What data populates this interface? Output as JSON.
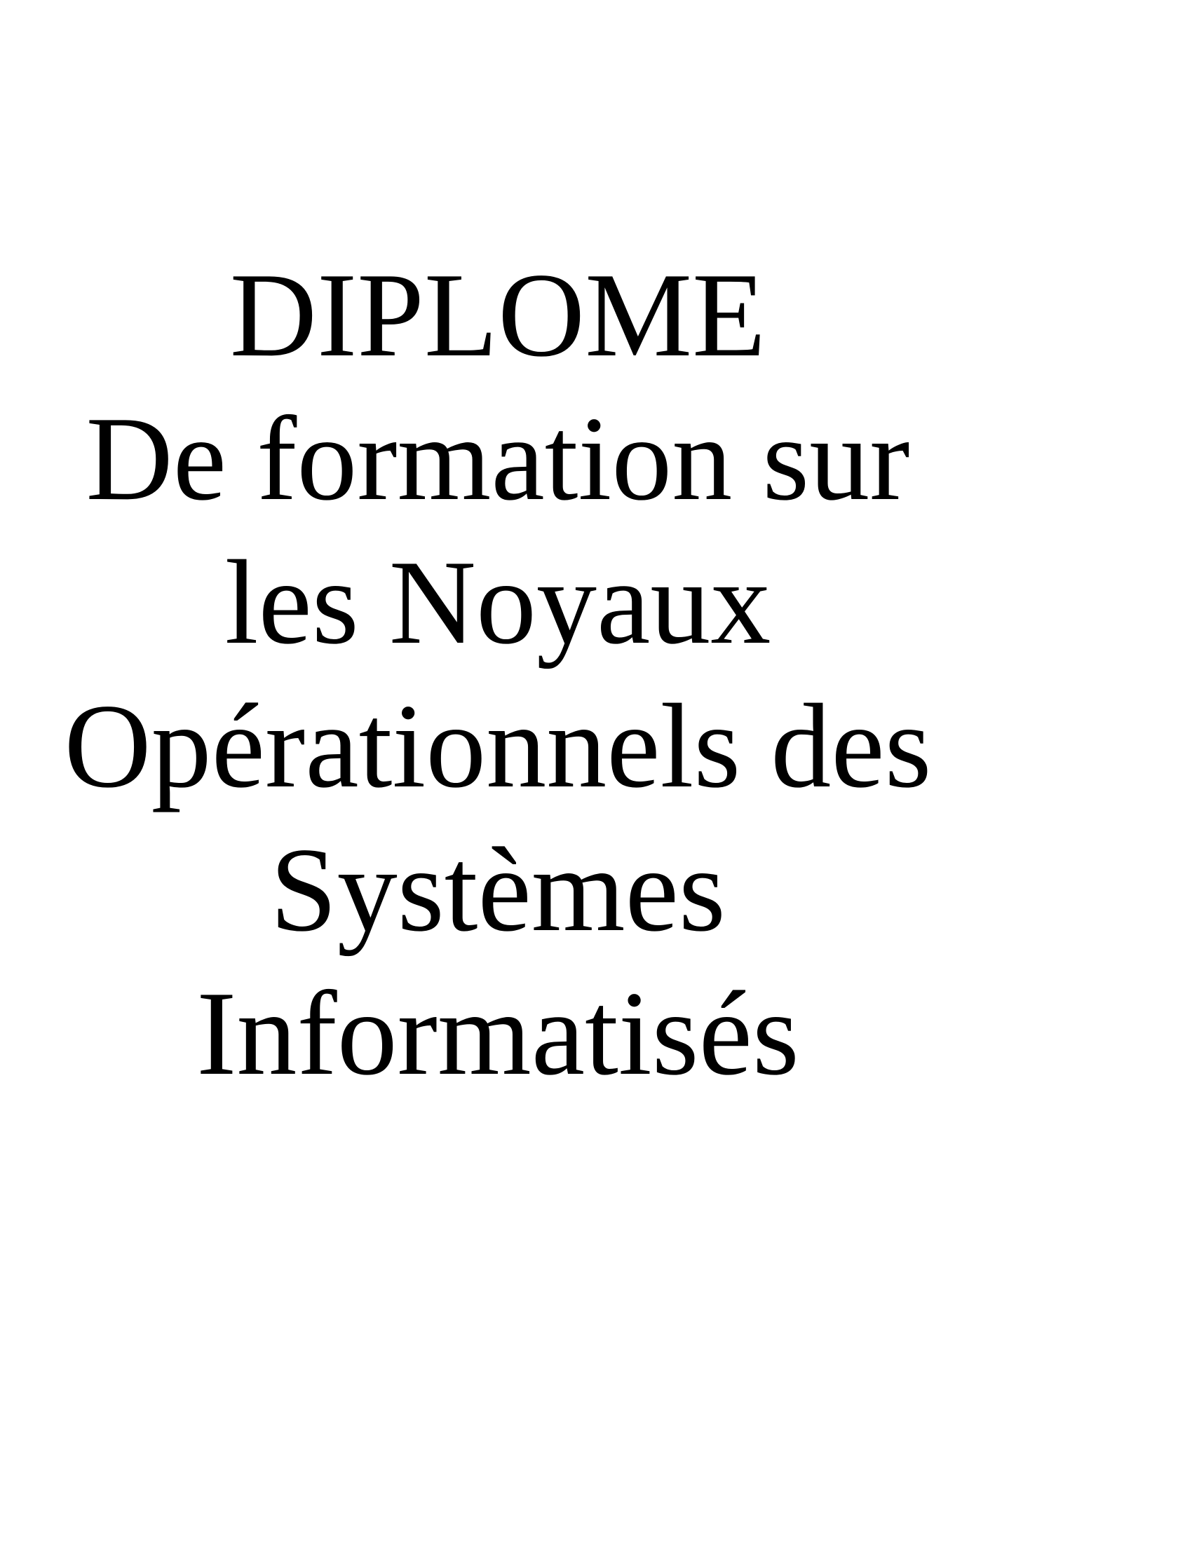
{
  "document": {
    "title": "DIPLOME",
    "subtitle_lines": [
      "De formation sur",
      "les Noyaux",
      "Opérationnels des",
      "Systèmes",
      "Informatisés"
    ]
  }
}
